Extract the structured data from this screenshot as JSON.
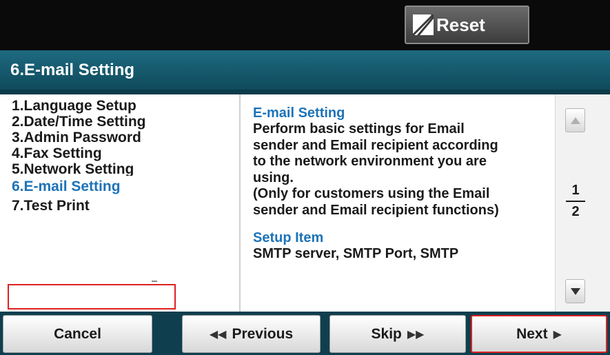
{
  "header": {
    "reset_label": "Reset"
  },
  "title": "6.E-mail Setting",
  "menu": {
    "items": [
      "1.Language Setup",
      "2.Date/Time Setting",
      "3.Admin Password",
      "4.Fax Setting",
      "5.Network Setting",
      "6.E-mail Setting",
      "7.Test Print"
    ],
    "selected_index": 5
  },
  "description": {
    "heading": "E-mail Setting",
    "text": "Perform basic settings for Email\nsender and Email recipient according\nto the network environment you are\nusing.\n  (Only for customers using the Email\nsender and Email recipient functions)",
    "setup_heading": "Setup Item",
    "setup_text": "SMTP server, SMTP Port, SMTP"
  },
  "pagination": {
    "current": "1",
    "total": "2"
  },
  "footer": {
    "cancel_label": "Cancel",
    "previous_label": "Previous",
    "skip_label": "Skip",
    "next_label": "Next"
  },
  "colors": {
    "title_bar": "#1e6a80",
    "accent_blue": "#1d73b8",
    "highlight_red": "#e02020",
    "top_bar": "#0a0a0a"
  }
}
